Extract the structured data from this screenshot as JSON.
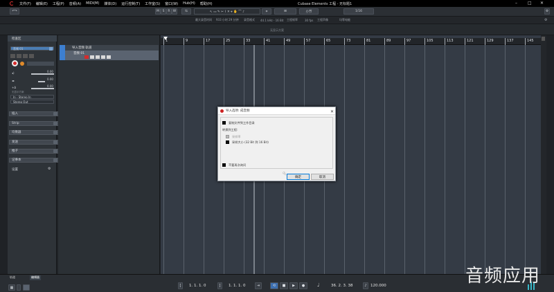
{
  "menu": {
    "items": [
      "文件(F)",
      "编辑(E)",
      "工程(P)",
      "音频(A)",
      "MIDI(M)",
      "媒体(D)",
      "运行控制(T)",
      "工作室(S)",
      "窗口(W)",
      "Hub(H)",
      "帮助(H)"
    ],
    "window_title": "Cubase Elements 工程 - 无标题1"
  },
  "toolbar": {
    "modes": [
      "M",
      "S",
      "R",
      "W"
    ],
    "snap": "小节",
    "quantize": "1/16"
  },
  "infobar": {
    "items": [
      "最大录音时间",
      "933 小时 29 分钟",
      "录音格式",
      "44.1 kHz - 16 Bit",
      "工程帧率",
      "30 fps",
      "工程声像",
      "均等电能"
    ]
  },
  "subbar": {
    "label": "无显示方案"
  },
  "inspector": {
    "title": "检查区",
    "track_name": "音频 01",
    "vol_value": "0.00",
    "pan_value": "0.00",
    "delay_value": "0.00",
    "routing_label": "无显示方案",
    "input": "In - Stereo In",
    "output": "Stereo Out",
    "sections": [
      "插入",
      "Strip",
      "均衡器",
      "发送",
      "推子",
      "记事本"
    ],
    "settings": "设置"
  },
  "tracks": {
    "folder": "导入音频 轨道",
    "audio": "音频 01"
  },
  "ruler": {
    "bars": [
      "1",
      "9",
      "17",
      "25",
      "33",
      "41",
      "49",
      "57",
      "65",
      "73",
      "81",
      "89",
      "97",
      "105",
      "113",
      "121",
      "129",
      "137",
      "145"
    ]
  },
  "bottom": {
    "tabs": [
      "轨道",
      "编辑器"
    ],
    "left_locator": "1. 1. 1. 0",
    "right_locator": "1. 1. 1. 0",
    "position": "36. 2. 3. 38",
    "tempo": "120.000"
  },
  "dialog": {
    "title": "导入选项: 成音频",
    "opt1": "复制文件到工作目录",
    "convert_label": "转换到工程:",
    "opt2": "采样率",
    "opt3": "采样大小 (32 Bit 到 16 Bit)",
    "opt4": "不要再次询问",
    "ok": "确定",
    "cancel": "取消"
  },
  "watermark": "音频应用"
}
